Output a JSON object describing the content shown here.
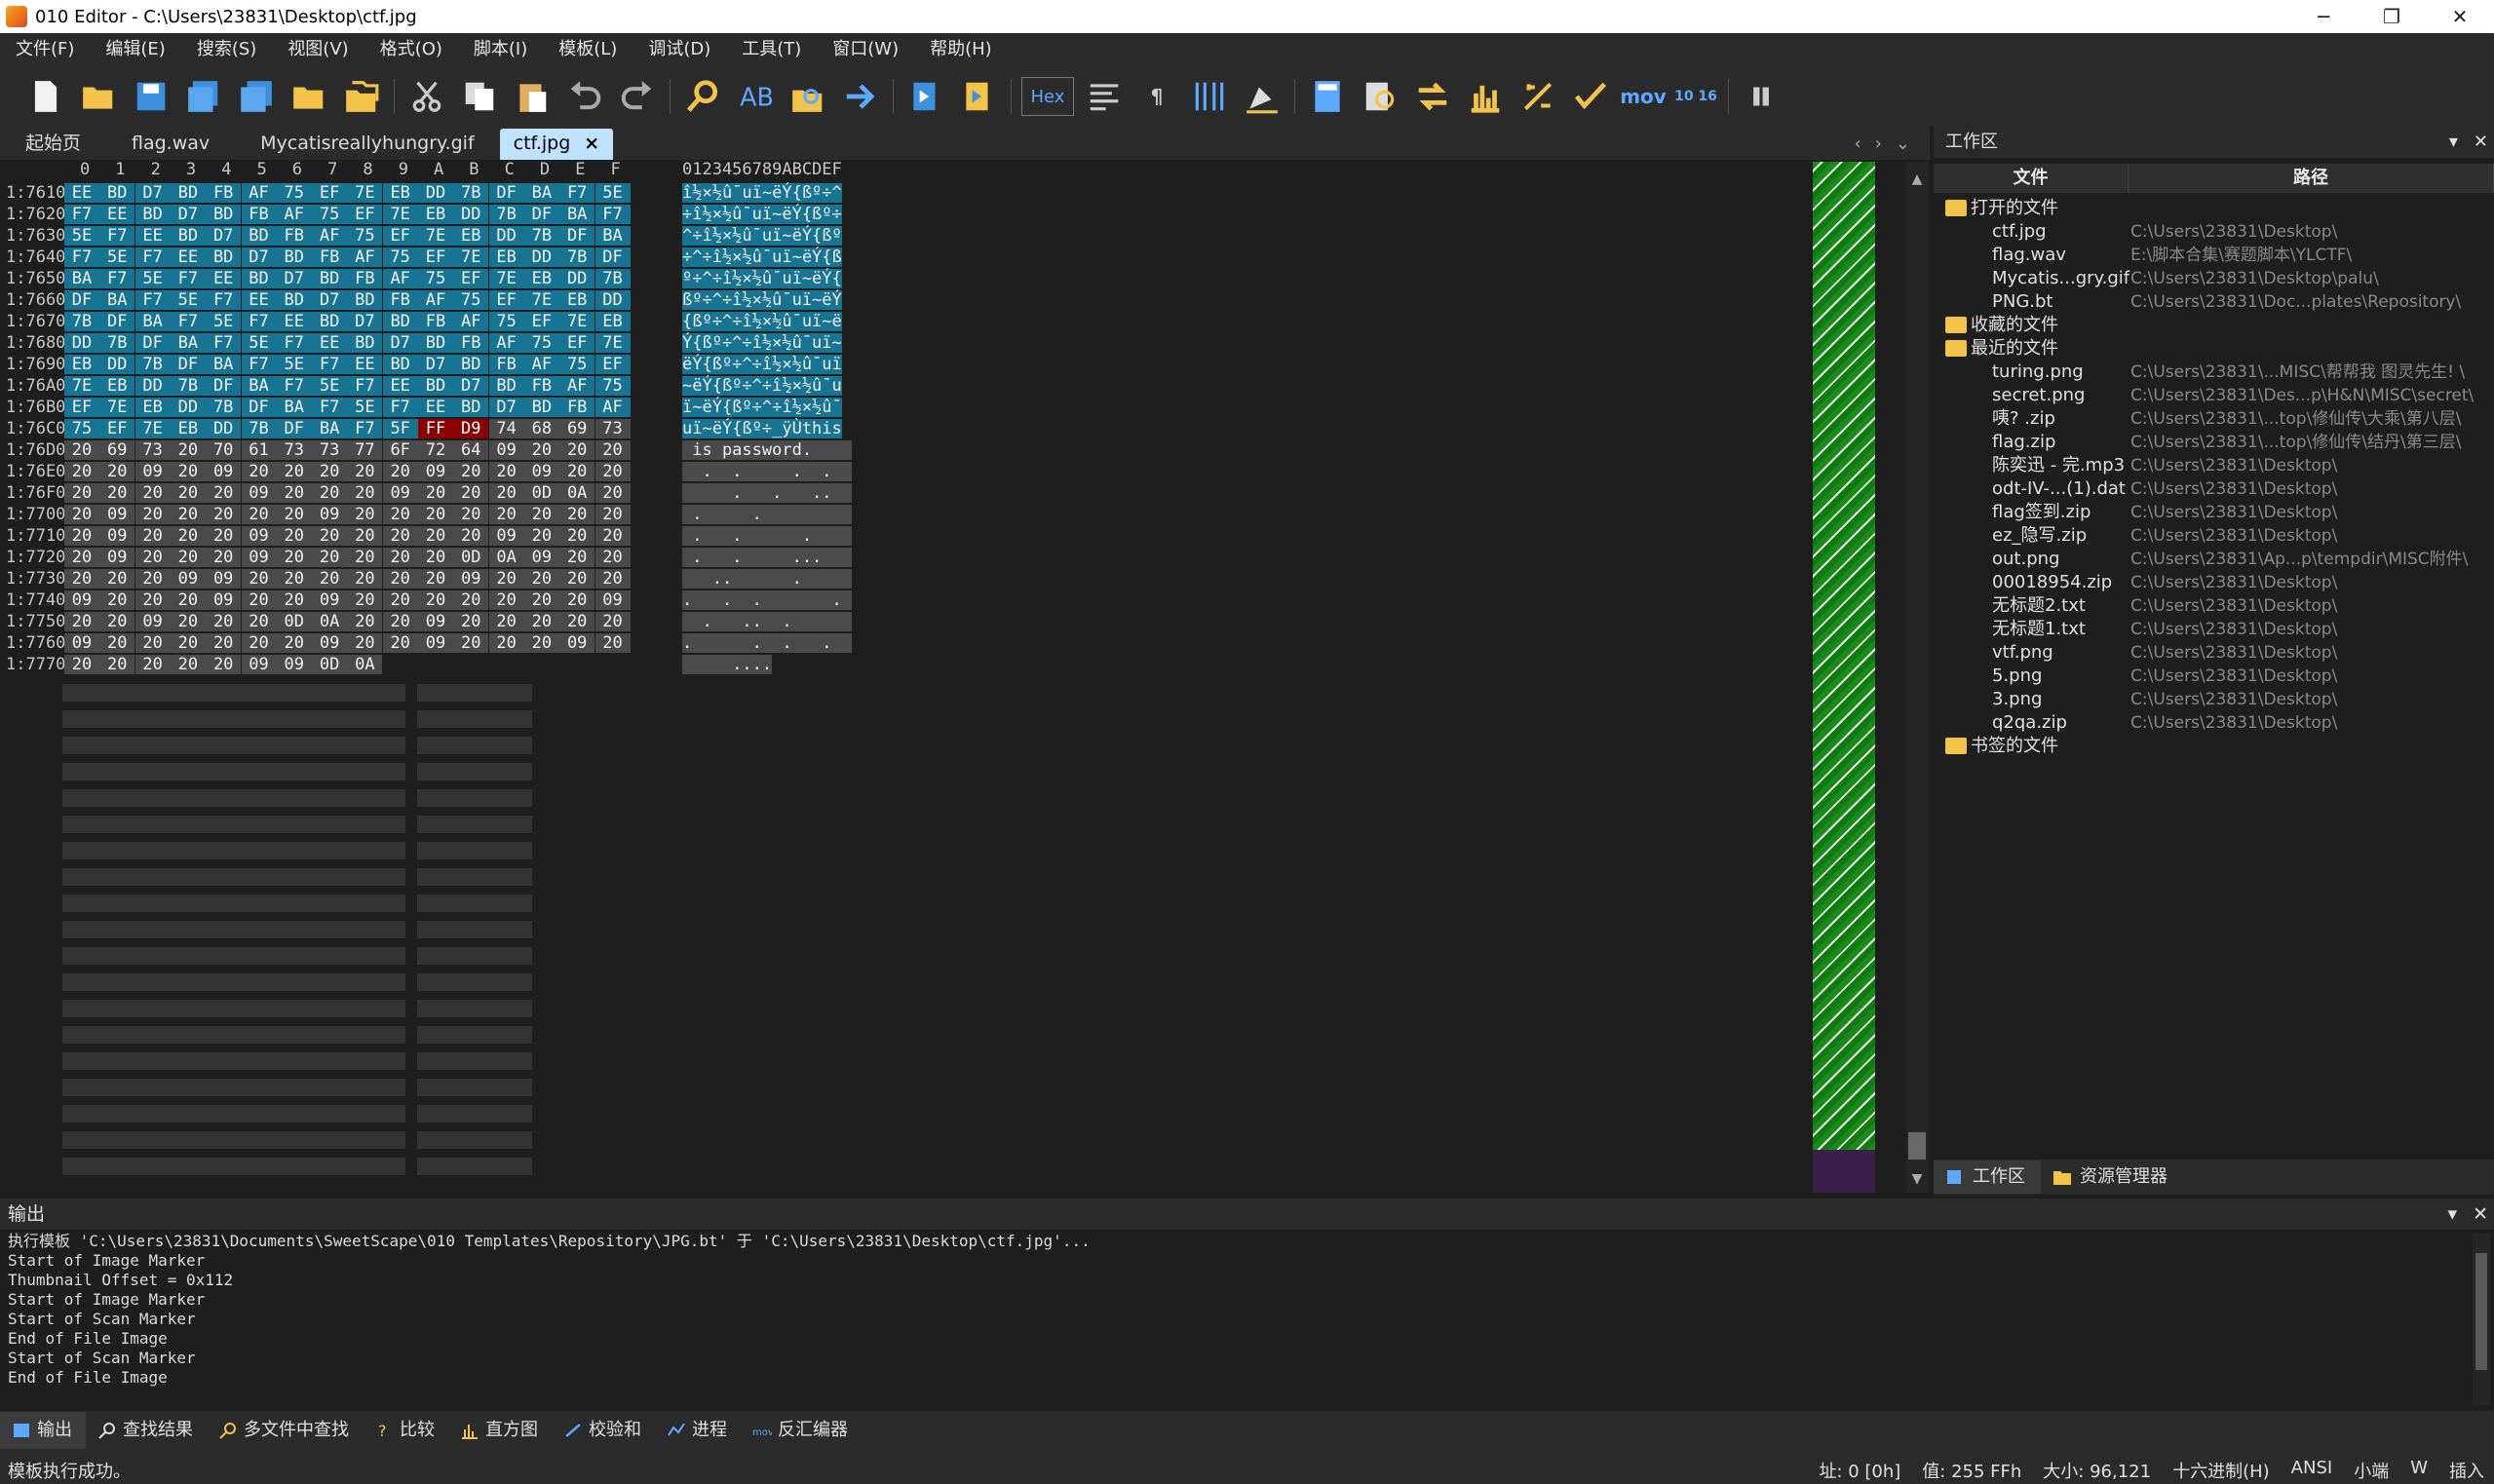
{
  "window": {
    "title": "010 Editor - C:\\Users\\23831\\Desktop\\ctf.jpg",
    "minimize": "─",
    "maximize": "❐",
    "close": "✕"
  },
  "menu": [
    "文件(F)",
    "编辑(E)",
    "搜索(S)",
    "视图(V)",
    "格式(O)",
    "脚本(I)",
    "模板(L)",
    "调试(D)",
    "工具(T)",
    "窗口(W)",
    "帮助(H)"
  ],
  "toolbar": {
    "hex_label": "Hex",
    "mov_label": "mov",
    "pilcrow": "¶",
    "base_label": "10 16",
    "icons": [
      "new-file-icon",
      "open-file-icon",
      "save-icon",
      "save-as-icon",
      "save-all-icon",
      "open-folder-icon",
      "open-workspace-icon",
      "cut-icon",
      "copy-icon",
      "paste-icon",
      "undo-icon",
      "redo-icon",
      "find-icon",
      "replace-icon",
      "find-in-files-icon",
      "goto-icon",
      "run-script-icon",
      "run-template-icon",
      "hex-mode-icon",
      "text-mode-icon",
      "show-whitespace-icon",
      "columns-icon",
      "highlight-icon",
      "calculator-icon",
      "inspector-icon",
      "compare-icon",
      "histogram-icon",
      "checksum-icon",
      "hash-icon",
      "disassembler-icon",
      "base-converter-icon",
      "pause-icon"
    ]
  },
  "tabs": [
    {
      "label": "起始页",
      "active": false
    },
    {
      "label": "flag.wav",
      "active": false
    },
    {
      "label": "Mycatisreallyhungry.gif",
      "active": false
    },
    {
      "label": "ctf.jpg",
      "active": true
    }
  ],
  "tab_close": "×",
  "tab_nav": {
    "prev": "‹",
    "next": "›",
    "list": "⌄"
  },
  "hex": {
    "col_headers": [
      "0",
      "1",
      "2",
      "3",
      "4",
      "5",
      "6",
      "7",
      "8",
      "9",
      "A",
      "B",
      "C",
      "D",
      "E",
      "F"
    ],
    "ascii_header": "0123456789ABCDEF",
    "rows": [
      {
        "addr": "1:7610h:",
        "bytes": [
          "EE",
          "BD",
          "D7",
          "BD",
          "FB",
          "AF",
          "75",
          "EF",
          "7E",
          "EB",
          "DD",
          "7B",
          "DF",
          "BA",
          "F7",
          "5E"
        ],
        "ascii": "î½×½û¯uï~ëÝ{ßº÷^",
        "style": "blue"
      },
      {
        "addr": "1:7620h:",
        "bytes": [
          "F7",
          "EE",
          "BD",
          "D7",
          "BD",
          "FB",
          "AF",
          "75",
          "EF",
          "7E",
          "EB",
          "DD",
          "7B",
          "DF",
          "BA",
          "F7"
        ],
        "ascii": "÷î½×½û¯uï~ëÝ{ßº÷",
        "style": "blue"
      },
      {
        "addr": "1:7630h:",
        "bytes": [
          "5E",
          "F7",
          "EE",
          "BD",
          "D7",
          "BD",
          "FB",
          "AF",
          "75",
          "EF",
          "7E",
          "EB",
          "DD",
          "7B",
          "DF",
          "BA"
        ],
        "ascii": "^÷î½×½û¯uï~ëÝ{ßº",
        "style": "blue"
      },
      {
        "addr": "1:7640h:",
        "bytes": [
          "F7",
          "5E",
          "F7",
          "EE",
          "BD",
          "D7",
          "BD",
          "FB",
          "AF",
          "75",
          "EF",
          "7E",
          "EB",
          "DD",
          "7B",
          "DF"
        ],
        "ascii": "÷^÷î½×½û¯uï~ëÝ{ß",
        "style": "blue"
      },
      {
        "addr": "1:7650h:",
        "bytes": [
          "BA",
          "F7",
          "5E",
          "F7",
          "EE",
          "BD",
          "D7",
          "BD",
          "FB",
          "AF",
          "75",
          "EF",
          "7E",
          "EB",
          "DD",
          "7B"
        ],
        "ascii": "º÷^÷î½×½û¯uï~ëÝ{",
        "style": "blue"
      },
      {
        "addr": "1:7660h:",
        "bytes": [
          "DF",
          "BA",
          "F7",
          "5E",
          "F7",
          "EE",
          "BD",
          "D7",
          "BD",
          "FB",
          "AF",
          "75",
          "EF",
          "7E",
          "EB",
          "DD"
        ],
        "ascii": "ßº÷^÷î½×½û¯uï~ëÝ",
        "style": "blue"
      },
      {
        "addr": "1:7670h:",
        "bytes": [
          "7B",
          "DF",
          "BA",
          "F7",
          "5E",
          "F7",
          "EE",
          "BD",
          "D7",
          "BD",
          "FB",
          "AF",
          "75",
          "EF",
          "7E",
          "EB"
        ],
        "ascii": "{ßº÷^÷î½×½û¯uï~ë",
        "style": "blue"
      },
      {
        "addr": "1:7680h:",
        "bytes": [
          "DD",
          "7B",
          "DF",
          "BA",
          "F7",
          "5E",
          "F7",
          "EE",
          "BD",
          "D7",
          "BD",
          "FB",
          "AF",
          "75",
          "EF",
          "7E"
        ],
        "ascii": "Ý{ßº÷^÷î½×½û¯uï~",
        "style": "blue"
      },
      {
        "addr": "1:7690h:",
        "bytes": [
          "EB",
          "DD",
          "7B",
          "DF",
          "BA",
          "F7",
          "5E",
          "F7",
          "EE",
          "BD",
          "D7",
          "BD",
          "FB",
          "AF",
          "75",
          "EF"
        ],
        "ascii": "ëÝ{ßº÷^÷î½×½û¯uï",
        "style": "blue"
      },
      {
        "addr": "1:76A0h:",
        "bytes": [
          "7E",
          "EB",
          "DD",
          "7B",
          "DF",
          "BA",
          "F7",
          "5E",
          "F7",
          "EE",
          "BD",
          "D7",
          "BD",
          "FB",
          "AF",
          "75"
        ],
        "ascii": "~ëÝ{ßº÷^÷î½×½û¯u",
        "style": "blue"
      },
      {
        "addr": "1:76B0h:",
        "bytes": [
          "EF",
          "7E",
          "EB",
          "DD",
          "7B",
          "DF",
          "BA",
          "F7",
          "5E",
          "F7",
          "EE",
          "BD",
          "D7",
          "BD",
          "FB",
          "AF"
        ],
        "ascii": "ï~ëÝ{ßº÷^÷î½×½û¯",
        "style": "blue"
      },
      {
        "addr": "1:76C0h:",
        "bytes": [
          "75",
          "EF",
          "7E",
          "EB",
          "DD",
          "7B",
          "DF",
          "BA",
          "F7",
          "5F",
          "FF",
          "D9",
          "74",
          "68",
          "69",
          "73"
        ],
        "ascii": "uï~ëÝ{ßº÷_ÿÙthis",
        "style": "mixed"
      },
      {
        "addr": "1:76D0h:",
        "bytes": [
          "20",
          "69",
          "73",
          "20",
          "70",
          "61",
          "73",
          "73",
          "77",
          "6F",
          "72",
          "64",
          "09",
          "20",
          "20",
          "20"
        ],
        "ascii": " is password.    ",
        "style": "gray"
      },
      {
        "addr": "1:76E0h:",
        "bytes": [
          "20",
          "20",
          "09",
          "20",
          "09",
          "20",
          "20",
          "20",
          "20",
          "20",
          "09",
          "20",
          "20",
          "09",
          "20",
          "20"
        ],
        "ascii": "  .  .     .  .  ",
        "style": "gray"
      },
      {
        "addr": "1:76F0h:",
        "bytes": [
          "20",
          "20",
          "20",
          "20",
          "20",
          "09",
          "20",
          "20",
          "20",
          "09",
          "20",
          "20",
          "20",
          "0D",
          "0A",
          "20"
        ],
        "ascii": "     .   .   ..  ",
        "style": "gray"
      },
      {
        "addr": "1:7700h:",
        "bytes": [
          "20",
          "09",
          "20",
          "20",
          "20",
          "20",
          "20",
          "09",
          "20",
          "20",
          "20",
          "20",
          "20",
          "20",
          "20",
          "20"
        ],
        "ascii": " .     .         ",
        "style": "gray"
      },
      {
        "addr": "1:7710h:",
        "bytes": [
          "20",
          "09",
          "20",
          "20",
          "20",
          "09",
          "20",
          "20",
          "20",
          "20",
          "20",
          "20",
          "09",
          "20",
          "20",
          "20"
        ],
        "ascii": " .   .      .    ",
        "style": "gray"
      },
      {
        "addr": "1:7720h:",
        "bytes": [
          "20",
          "09",
          "20",
          "20",
          "20",
          "09",
          "20",
          "20",
          "20",
          "20",
          "20",
          "0D",
          "0A",
          "09",
          "20",
          "20"
        ],
        "ascii": " .   .     ...   ",
        "style": "gray"
      },
      {
        "addr": "1:7730h:",
        "bytes": [
          "20",
          "20",
          "20",
          "09",
          "09",
          "20",
          "20",
          "20",
          "20",
          "20",
          "20",
          "09",
          "20",
          "20",
          "20",
          "20"
        ],
        "ascii": "   ..      .     ",
        "style": "gray"
      },
      {
        "addr": "1:7740h:",
        "bytes": [
          "09",
          "20",
          "20",
          "20",
          "09",
          "20",
          "20",
          "09",
          "20",
          "20",
          "20",
          "20",
          "20",
          "20",
          "20",
          "09"
        ],
        "ascii": ".   .  .       . ",
        "style": "gray"
      },
      {
        "addr": "1:7750h:",
        "bytes": [
          "20",
          "20",
          "09",
          "20",
          "20",
          "20",
          "0D",
          "0A",
          "20",
          "20",
          "09",
          "20",
          "20",
          "20",
          "20",
          "20"
        ],
        "ascii": "  .   ..  .      ",
        "style": "gray"
      },
      {
        "addr": "1:7760h:",
        "bytes": [
          "09",
          "20",
          "20",
          "20",
          "20",
          "20",
          "20",
          "09",
          "20",
          "20",
          "09",
          "20",
          "20",
          "20",
          "09",
          "20"
        ],
        "ascii": ".      .  .   .  ",
        "style": "gray"
      },
      {
        "addr": "1:7770h:",
        "bytes": [
          "20",
          "20",
          "20",
          "20",
          "20",
          "09",
          "09",
          "0D",
          "0A"
        ],
        "ascii": "     ....",
        "style": "gray"
      }
    ]
  },
  "workspace": {
    "title": "工作区",
    "col_file": "文件",
    "col_path": "路径",
    "groups": [
      {
        "label": "打开的文件",
        "items": [
          {
            "name": "ctf.jpg",
            "path": "C:\\Users\\23831\\Desktop\\"
          },
          {
            "name": "flag.wav",
            "path": "E:\\脚本合集\\赛题脚本\\YLCTF\\"
          },
          {
            "name": "Mycatis...gry.gif",
            "path": "C:\\Users\\23831\\Desktop\\palu\\"
          },
          {
            "name": "PNG.bt",
            "path": "C:\\Users\\23831\\Doc...plates\\Repository\\"
          }
        ]
      },
      {
        "label": "收藏的文件",
        "items": []
      },
      {
        "label": "最近的文件",
        "items": [
          {
            "name": "turing.png",
            "path": "C:\\Users\\23831\\...MISC\\帮帮我 图灵先生! \\"
          },
          {
            "name": "secret.png",
            "path": "C:\\Users\\23831\\Des...p\\H&N\\MISC\\secret\\"
          },
          {
            "name": "咦? .zip",
            "path": "C:\\Users\\23831\\...top\\修仙传\\大乘\\第八层\\"
          },
          {
            "name": "flag.zip",
            "path": "C:\\Users\\23831\\...top\\修仙传\\结丹\\第三层\\"
          },
          {
            "name": "陈奕迅 - 完.mp3",
            "path": "C:\\Users\\23831\\Desktop\\"
          },
          {
            "name": "odt-IV-...(1).dat",
            "path": "C:\\Users\\23831\\Desktop\\"
          },
          {
            "name": "flag签到.zip",
            "path": "C:\\Users\\23831\\Desktop\\"
          },
          {
            "name": "ez_隐写.zip",
            "path": "C:\\Users\\23831\\Desktop\\"
          },
          {
            "name": "out.png",
            "path": "C:\\Users\\23831\\Ap...p\\tempdir\\MISC附件\\"
          },
          {
            "name": "00018954.zip",
            "path": "C:\\Users\\23831\\Desktop\\"
          },
          {
            "name": "无标题2.txt",
            "path": "C:\\Users\\23831\\Desktop\\"
          },
          {
            "name": "无标题1.txt",
            "path": "C:\\Users\\23831\\Desktop\\"
          },
          {
            "name": "vtf.png",
            "path": "C:\\Users\\23831\\Desktop\\"
          },
          {
            "name": "5.png",
            "path": "C:\\Users\\23831\\Desktop\\"
          },
          {
            "name": "3.png",
            "path": "C:\\Users\\23831\\Desktop\\"
          },
          {
            "name": "q2qa.zip",
            "path": "C:\\Users\\23831\\Desktop\\"
          }
        ]
      },
      {
        "label": "书签的文件",
        "items": []
      }
    ],
    "tab_workspace": "工作区",
    "tab_explorer": "资源管理器"
  },
  "output": {
    "title": "输出",
    "lines": [
      "执行模板 'C:\\Users\\23831\\Documents\\SweetScape\\010 Templates\\Repository\\JPG.bt' 于 'C:\\Users\\23831\\Desktop\\ctf.jpg'...",
      "Start of Image Marker",
      "Thumbnail Offset = 0x112",
      "Start of Image Marker",
      "Start of Scan Marker",
      "End of File Image",
      "Start of Scan Marker",
      "End of File Image"
    ]
  },
  "bottom_tabs": [
    "输出",
    "查找结果",
    "多文件中查找",
    "比较",
    "直方图",
    "校验和",
    "进程",
    "反汇编器"
  ],
  "status": {
    "message": "模板执行成功。",
    "address": "址: 0 [0h]",
    "value": "值: 255 FFh",
    "size": "大小: 96,121",
    "mode": "十六进制(H)",
    "encoding": "ANSI",
    "endian": "小端",
    "write": "W",
    "insert": "插入"
  },
  "colors": {
    "selection_blue": "#177493",
    "eof_marker_red": "#8b0000",
    "appended_gray": "#4a4a4a",
    "active_tab": "#bfe3ff"
  }
}
